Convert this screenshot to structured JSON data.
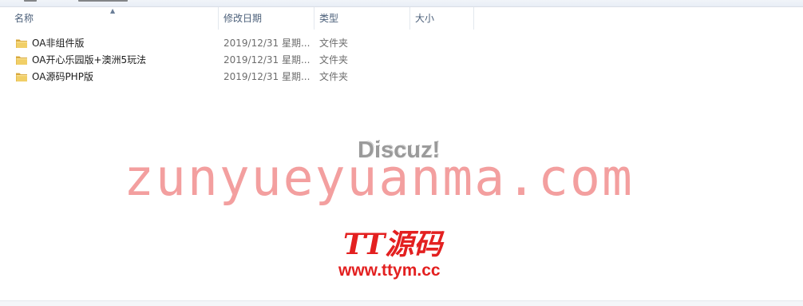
{
  "columns": {
    "name": "名称",
    "date_modified": "修改日期",
    "type": "类型",
    "size": "大小"
  },
  "files": [
    {
      "name": "OA非组件版",
      "date": "2019/12/31 星期...",
      "type": "文件夹",
      "icon": "folder-icon"
    },
    {
      "name": "OA开心乐园版+澳洲5玩法",
      "date": "2019/12/31 星期...",
      "type": "文件夹",
      "icon": "folder-icon"
    },
    {
      "name": "OA源码PHP版",
      "date": "2019/12/31 星期...",
      "type": "文件夹",
      "icon": "folder-icon"
    }
  ],
  "watermarks": {
    "discuz": "Discuz!",
    "site": "zunyueyuanma.com",
    "tt_logo": "TT源码",
    "tt_url": "www.ttym.cc"
  },
  "colors": {
    "folder": "#e8c45a",
    "watermark_pink": "#f07f7f",
    "watermark_red": "#e32020"
  }
}
